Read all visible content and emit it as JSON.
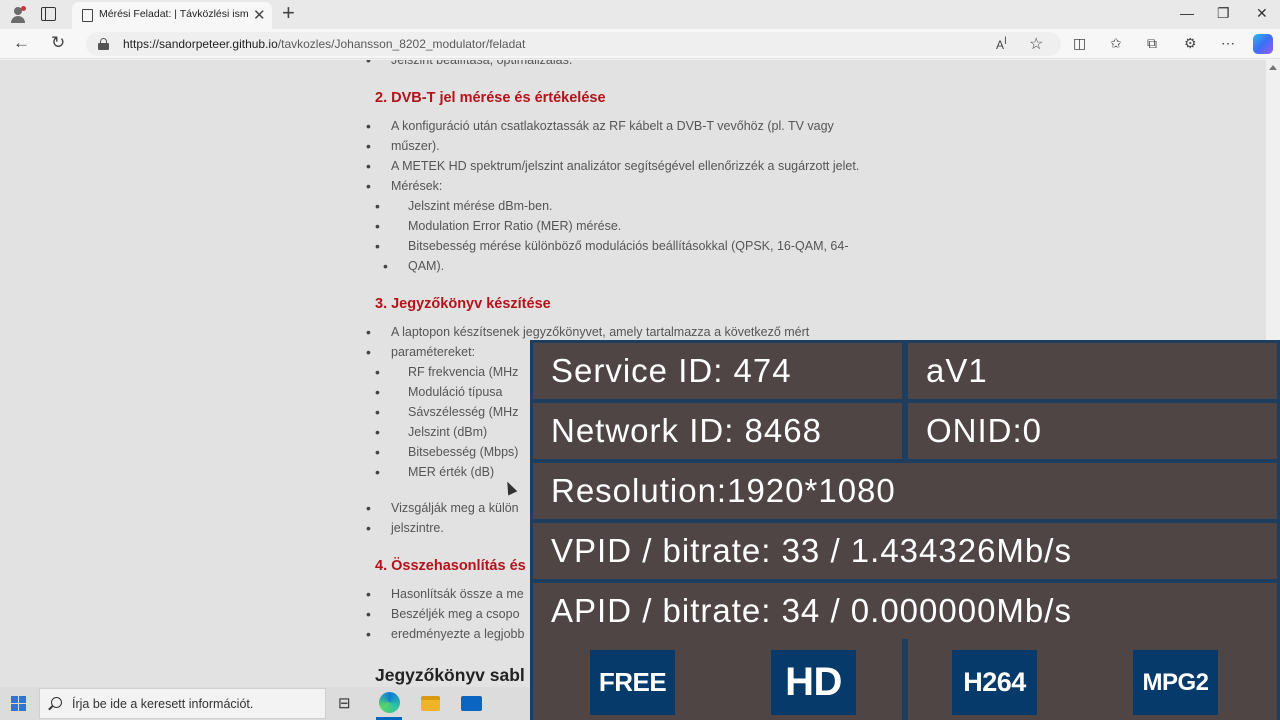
{
  "browser": {
    "tab_title": "Mérési Feladat: | Távközlési ismere",
    "url_host": "https://sandorpeteer.github.io",
    "url_path": "/tavkozles/Johansson_8202_modulator/feladat"
  },
  "page": {
    "cut_line": "Jelszint beállítása, optimalizálás.",
    "s2": {
      "heading": "2. DVB-T jel mérése és értékelése",
      "b1a": "A konfiguráció után csatlakoztassák az RF kábelt a DVB-T vevőhöz (pl. TV vagy",
      "b1b": "műszer).",
      "b2": "A METEK HD spektrum/jelszint analizátor segítségével ellenőrizzék a sugárzott jelet.",
      "b3": "Mérések:",
      "m1": "Jelszint mérése dBm-ben.",
      "m2": "Modulation Error Ratio (MER) mérése.",
      "m3a": "Bitsebesség mérése különböző modulációs beállításokkal (QPSK, 16-QAM, 64-",
      "m3b": "QAM)."
    },
    "s3": {
      "heading": "3. Jegyzőkönyv készítése",
      "b1a": "A laptopon készítsenek jegyzőkönyvet, amely tartalmazza a következő mért",
      "b1b": "paramétereket:",
      "p1": "RF frekvencia (MHz",
      "p2": "Moduláció típusa",
      "p3": "Sávszélesség (MHz",
      "p4": "Jelszint (dBm)",
      "p5": "Bitsebesség (Mbps)",
      "p6": "MER érték (dB)",
      "b2a": "Vizsgálják meg a külön",
      "b2b": "jelszintre."
    },
    "s4": {
      "heading": "4. Összehasonlítás és",
      "b1": "Hasonlítsák össze a me",
      "b2a": "Beszéljék meg a csopo",
      "b2b": "eredményezte a legjobb"
    },
    "s5_heading": "Jegyzőkönyv sabl"
  },
  "overlay": {
    "service_id": "Service ID: 474",
    "service_name": "aV1",
    "network_id": "Network ID: 8468",
    "onid": "ONID:0",
    "resolution": "Resolution:1920*1080",
    "vpid": "VPID / bitrate: 33 / 1.434326Mb/s",
    "apid": "APID / bitrate: 34 / 0.000000Mb/s",
    "badges": [
      "FREE",
      "HD",
      "H264",
      "MPG2"
    ]
  },
  "taskbar": {
    "search_placeholder": "Írja be ide a keresett információt."
  },
  "colors": {
    "heading_red": "#b5121b",
    "overlay_cell": "#4f4545",
    "overlay_border": "#1d3e5e",
    "badge_blue": "#063a6b"
  }
}
